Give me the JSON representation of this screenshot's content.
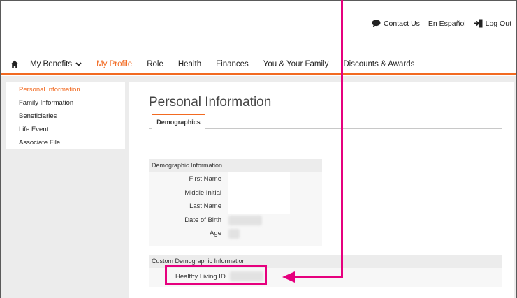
{
  "utility": {
    "contact": "Contact Us",
    "espanol": "En Español",
    "logout": "Log Out"
  },
  "nav": {
    "home_icon": "home-icon",
    "items": [
      "My Benefits",
      "My Profile",
      "Role",
      "Health",
      "Finances",
      "You & Your Family",
      "Discounts & Awards"
    ],
    "active": "My Profile",
    "accent": "#f26a21"
  },
  "sidebar": {
    "items": [
      "Personal Information",
      "Family Information",
      "Beneficiaries",
      "Life Event",
      "Associate File"
    ],
    "active": "Personal Information"
  },
  "main": {
    "title": "Personal Information",
    "tab": "Demographics",
    "demographic": {
      "header": "Demographic Information",
      "labels": [
        "First Name",
        "Middle Initial",
        "Last Name",
        "Date of Birth",
        "Age"
      ]
    },
    "custom": {
      "header": "Custom Demographic Information",
      "label": "Healthy Living ID"
    }
  },
  "annotation": {
    "color": "#e6007e"
  }
}
